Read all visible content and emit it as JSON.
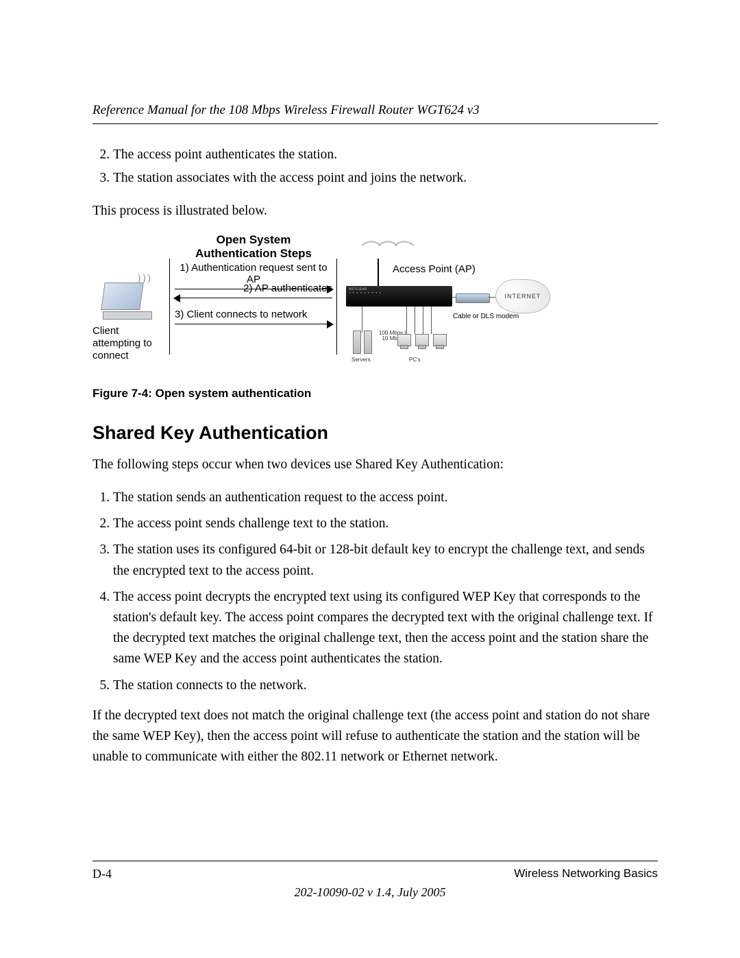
{
  "header": {
    "title": "Reference Manual for the 108 Mbps Wireless Firewall Router WGT624 v3"
  },
  "list_top": {
    "start": 2,
    "items": [
      "The access point authenticates the station.",
      "The station associates with the access point and joins the network."
    ]
  },
  "para_intro": "This process is illustrated below.",
  "figure": {
    "title": "Open System Authentication Steps",
    "client_label": "Client attempting to connect",
    "step1": "1) Authentication request sent to AP",
    "step2": "2) AP authenticates",
    "step3": "3) Client connects to network",
    "ap_label": "Access Point (AP)",
    "servers_label": "Servers",
    "pcs_label": "PC's",
    "mbps_line1": "100 Mbps",
    "mbps_line2": "10 Mbps",
    "modem_label": "Cable or DLS modem",
    "internet_label": "INTERNET",
    "router_brand": "NETGEAR"
  },
  "figure_caption": "Figure 7-4:  Open system authentication",
  "section_heading": "Shared Key Authentication",
  "para_section_intro": "The following steps occur when two devices use Shared Key Authentication:",
  "list_main": {
    "start": 1,
    "items": [
      "The station sends an authentication request to the access point.",
      "The access point sends challenge text to the station.",
      "The station uses its configured 64-bit or 128-bit default key to encrypt the challenge text, and sends the encrypted text to the access point.",
      "The access point decrypts the encrypted text using its configured WEP Key that corresponds to the station's default key. The access point compares the decrypted text with the original challenge text. If the decrypted text matches the original challenge text, then the access point and the station share the same WEP Key and the access point authenticates the station.",
      "The station connects to the network."
    ]
  },
  "para_trailing": "If the decrypted text does not match the original challenge text (the access point and station do not share the same WEP Key), then the access point will refuse to authenticate the station and the station will be unable to communicate with either the 802.11 network or Ethernet network.",
  "footer": {
    "page": "D-4",
    "section": "Wireless Networking Basics",
    "docnum": "202-10090-02 v 1.4, July 2005"
  }
}
